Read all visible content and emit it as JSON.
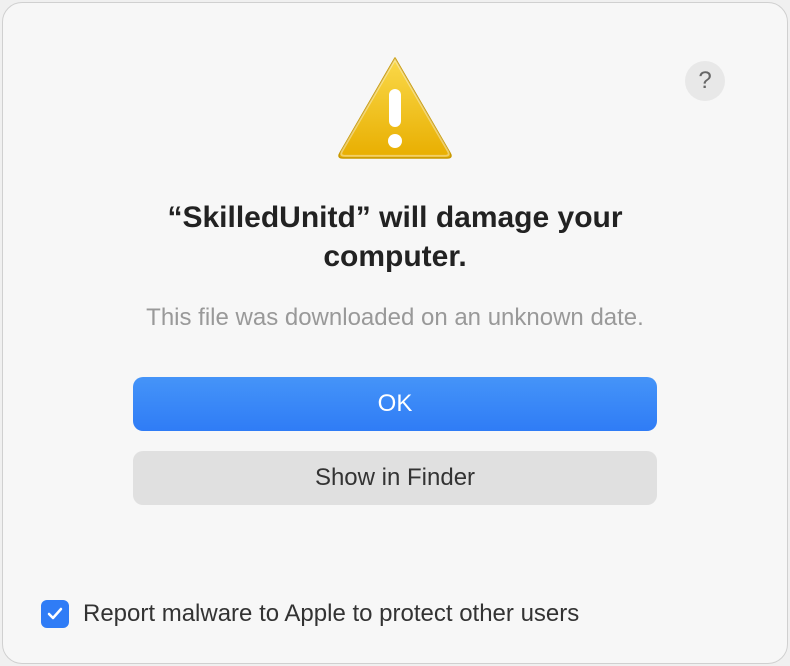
{
  "dialog": {
    "title": "“SkilledUnitd” will damage your computer.",
    "subtitle": "This file was downloaded on an unknown date.",
    "primary_button": "OK",
    "secondary_button": "Show in Finder",
    "checkbox_label": "Report malware to Apple to protect other users",
    "help_label": "?",
    "checkbox_checked": true
  },
  "icons": {
    "warning": "warning-triangle-icon",
    "help": "help-icon",
    "checkmark": "checkmark-icon"
  },
  "colors": {
    "primary_blue": "#2f7cf6",
    "warning_yellow": "#f5c518",
    "text_dark": "#222",
    "text_muted": "#999"
  }
}
